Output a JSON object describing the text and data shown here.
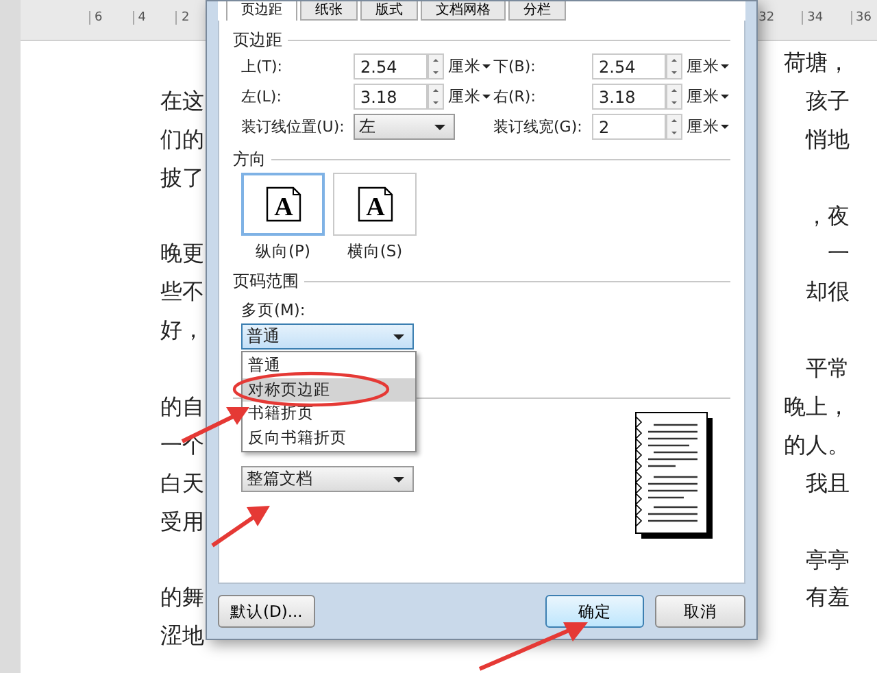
{
  "ruler": {
    "left_marks": [
      "6",
      "4",
      "2"
    ],
    "right_marks": [
      "32",
      "34",
      "36"
    ]
  },
  "document": {
    "lines": [
      {
        "right": "荷塘，"
      },
      {
        "left": "在这",
        "right": "孩子"
      },
      {
        "left": "们的",
        "right": "悄地"
      },
      {
        "left": "披了"
      },
      {
        "right": "，夜"
      },
      {
        "left": "晚更",
        "right": "一"
      },
      {
        "left": "些不",
        "right": "却很"
      },
      {
        "left": "好，"
      },
      {
        "right": "平常"
      },
      {
        "left": "的自",
        "right": "晚上，"
      },
      {
        "left": "一个",
        "right": "的人。"
      },
      {
        "left": "白天",
        "right": "我且"
      },
      {
        "left": "受用"
      },
      {
        "right": "亭亭"
      },
      {
        "left": "的舞",
        "right": "有羞"
      },
      {
        "left": "涩地"
      }
    ]
  },
  "dialog": {
    "tabs": [
      {
        "label": "页边距",
        "selected": true
      },
      {
        "label": "纸张",
        "selected": false
      },
      {
        "label": "版式",
        "selected": false
      },
      {
        "label": "文档网格",
        "selected": false
      },
      {
        "label": "分栏",
        "selected": false
      }
    ],
    "margins": {
      "title": "页边距",
      "fields": [
        {
          "label": "上(T):",
          "value": "2.54",
          "unit": "厘米"
        },
        {
          "label": "下(B):",
          "value": "2.54",
          "unit": "厘米"
        },
        {
          "label": "左(L):",
          "value": "3.18",
          "unit": "厘米"
        },
        {
          "label": "右(R):",
          "value": "3.18",
          "unit": "厘米"
        }
      ],
      "gutter_position": {
        "label": "装订线位置(U):",
        "value": "左"
      },
      "gutter": {
        "label": "装订线宽(G):",
        "value": "2",
        "unit": "厘米"
      }
    },
    "orientation": {
      "title": "方向",
      "options": [
        {
          "label": "纵向(P)",
          "glyph": "A",
          "selected": true
        },
        {
          "label": "横向(S)",
          "glyph": "A",
          "selected": false
        }
      ]
    },
    "pages": {
      "title": "页码范围",
      "label": "多页(M):",
      "value": "普通",
      "expanded": true,
      "options": [
        {
          "label": "普通",
          "highlighted": false
        },
        {
          "label": "对称页边距",
          "highlighted": true
        },
        {
          "label": "书籍折页",
          "highlighted": false
        },
        {
          "label": "反向书籍折页",
          "highlighted": false
        }
      ]
    },
    "preview": {
      "apply_value": "整篇文档"
    },
    "buttons": {
      "default": "默认(D)...",
      "ok": "确定",
      "cancel": "取消"
    }
  }
}
